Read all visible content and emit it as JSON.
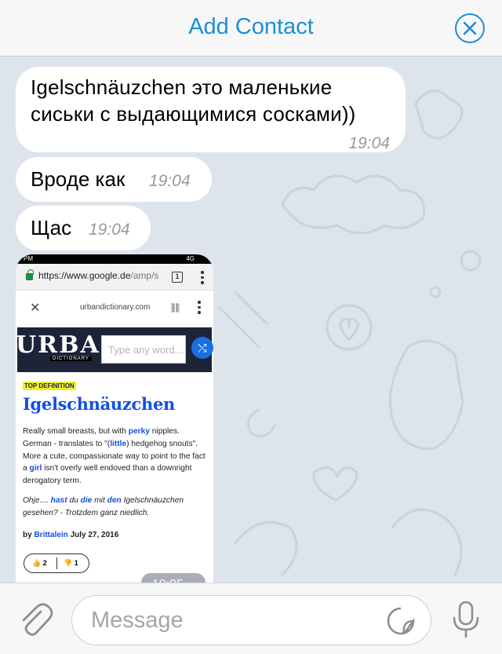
{
  "header": {
    "title": "Add Contact",
    "close_icon": "close-circle-icon"
  },
  "messages": [
    {
      "text_line1": "Igelschnäuzchen это маленькие",
      "text_line2": "сиськи с выдающимися сосками))",
      "time": "19:04"
    },
    {
      "text": "Вроде как",
      "time": "19:04"
    },
    {
      "text": "Щас",
      "time": "19:04"
    }
  ],
  "photo": {
    "status_time": "PM",
    "status_right": "4G",
    "url_host": "https://www.google.de",
    "url_path": "/amp/s",
    "tabs_count": "1",
    "domain": "urbandictionary.com",
    "logo": "URBAN",
    "logo_sub": "DICTIONARY",
    "search_placeholder": "Type any word...",
    "top_label": "TOP DEFINITION",
    "word": "Igelschnäuzchen",
    "meaning": {
      "p1": "Really small breasts, but with ",
      "k1": "perky",
      "p2": " nipples. German - translates to \"(",
      "k2": "little",
      "p3": ") hedgehog snouts\". More a cute, compassionate way to point to the fact a ",
      "k3": "girl",
      "p4": " isn't overly well endoved than a downright derogatory term."
    },
    "example": {
      "p1": "Ohje.... ",
      "k1": "hast",
      "p2": " du ",
      "k2": "die",
      "p3": " mit ",
      "k3": "den",
      "p4": " Igelschnäuzchen gesehen? - Trotzdem ganz niedlich."
    },
    "author_prefix": "by ",
    "author": "Brittalein",
    "date": " July 27, 2016",
    "upvotes": "2",
    "downvotes": "1",
    "time": "19:05"
  },
  "input": {
    "placeholder": "Message"
  },
  "colors": {
    "accent": "#1a8fd6",
    "chat_bg": "#dde4ec",
    "ud_blue": "#134fe6",
    "ud_navy": "#1d2439"
  }
}
